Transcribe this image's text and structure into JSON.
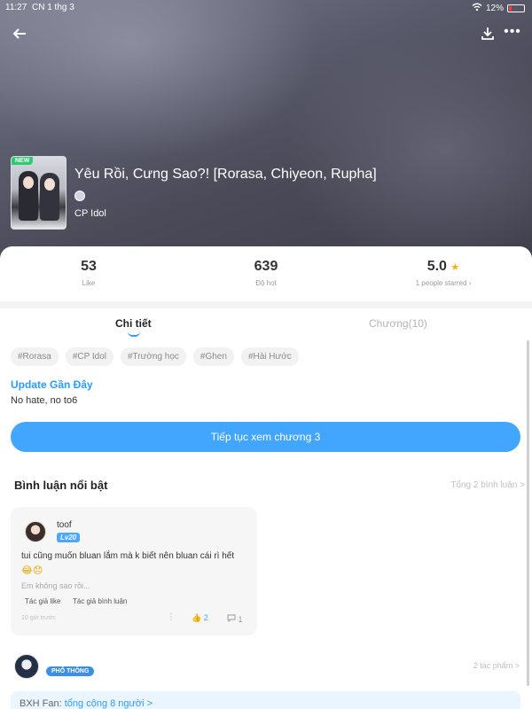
{
  "status": {
    "time": "11:27",
    "date": "CN 1 thg 3",
    "battery": "12%"
  },
  "header": {
    "new_badge": "NEW",
    "title": "Yêu Rồi, Cưng Sao?! [Rorasa, Chiyeon, Rupha]",
    "category": "CP Idol"
  },
  "stats": {
    "like_value": "53",
    "like_label": "Like",
    "hot_value": "639",
    "hot_label": "Độ hot",
    "rating_value": "5.0",
    "rating_label": "1 people starred",
    "star_icon": "★"
  },
  "tabs": {
    "detail": "Chi tiết",
    "chapter": "Chương(10)"
  },
  "tags": [
    "#Rorasa",
    "#CP Idol",
    "#Trường học",
    "#Ghen",
    "#Hài Hước"
  ],
  "update": {
    "title": "Update Gần Đây",
    "text": "No hate, no to6"
  },
  "cta": {
    "label": "Tiếp tục xem chương 3"
  },
  "comments": {
    "title": "Bình luận nổi bật",
    "total": "Tổng 2 bình luận >",
    "user": "toof",
    "level": "Lv20",
    "text": "tui cũng muốn bluan lắm mà k biết nên bluan cái rì hết",
    "emoji": "😂😞",
    "reply_preview": "Em không sao rồi...",
    "action_author_like": "Tác giả like",
    "action_author_comment": "Tác giả bình luận",
    "time": "10 giờ trước",
    "like_count": "2",
    "reply_count": "1"
  },
  "author": {
    "badge": "PHỔ THÔNG",
    "works": "2 tác phẩm >"
  },
  "fans": {
    "label": "BXH Fan:",
    "link": "tổng cộng 8 người >"
  }
}
